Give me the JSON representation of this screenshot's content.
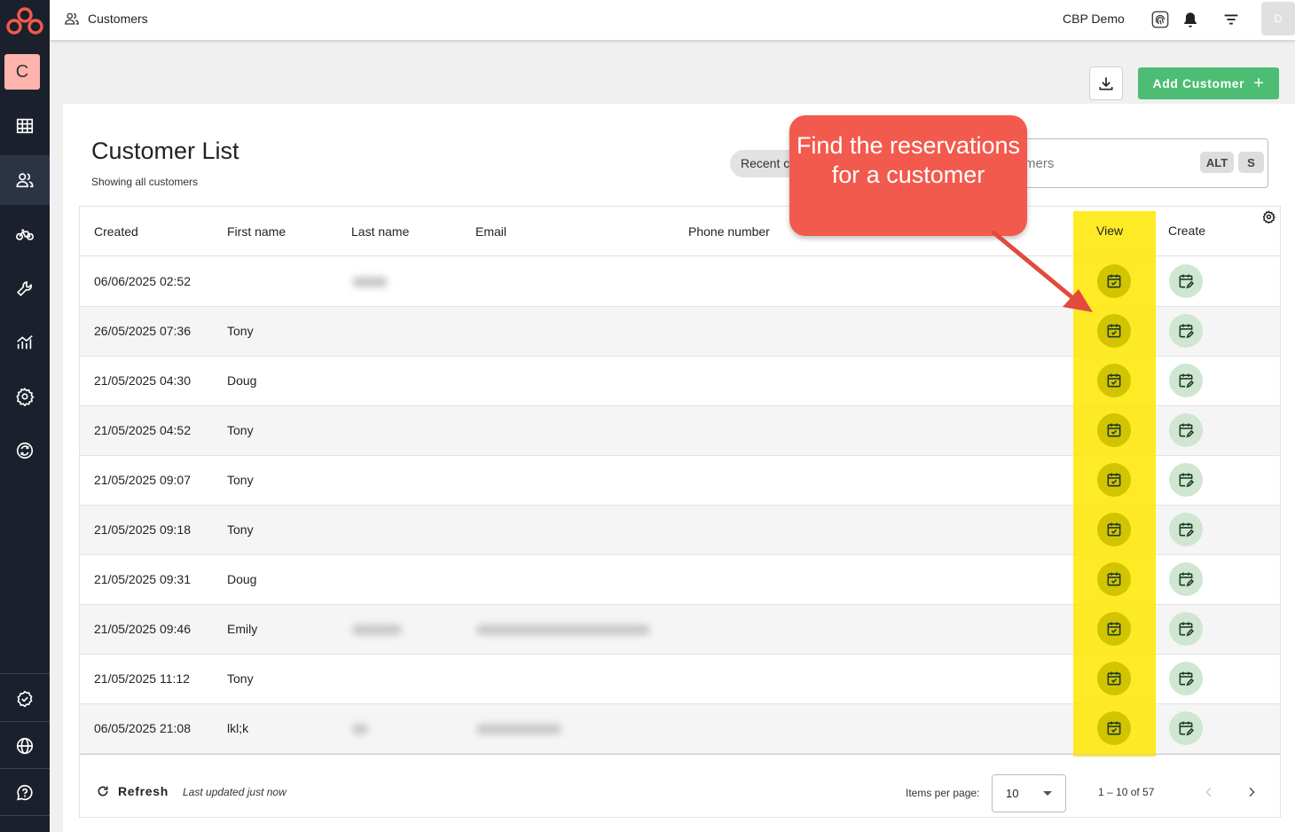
{
  "app": {
    "page_title": "Customers",
    "org_name": "CBP Demo",
    "avatar_initial": "D",
    "org_badge": "C"
  },
  "sidebar": {
    "items": [
      {
        "name": "dashboard",
        "icon": "grid-icon"
      },
      {
        "name": "customers",
        "icon": "users-icon",
        "active": true
      },
      {
        "name": "bikes",
        "icon": "bike-icon"
      },
      {
        "name": "service",
        "icon": "wrench-icon"
      },
      {
        "name": "reports",
        "icon": "chart-icon"
      },
      {
        "name": "settings",
        "icon": "gear-icon"
      },
      {
        "name": "sync",
        "icon": "sync-icon"
      },
      {
        "name": "verified",
        "icon": "badge-check-icon"
      },
      {
        "name": "globe",
        "icon": "globe-icon"
      },
      {
        "name": "help",
        "icon": "help-icon"
      }
    ]
  },
  "actions": {
    "add_customer_label": "Add Customer",
    "add_icon": "+"
  },
  "list": {
    "title": "Customer List",
    "subtitle": "Showing all customers",
    "chip_label": "Recent c",
    "search_placeholder": "mers",
    "kbd_alt": "ALT",
    "kbd_s": "S"
  },
  "table": {
    "columns": [
      "Created",
      "First name",
      "Last name",
      "Email",
      "Phone number",
      "View",
      "Create"
    ],
    "rows": [
      {
        "created": "06/06/2025 02:52",
        "first": ""
      },
      {
        "created": "26/05/2025 07:36",
        "first": "Tony"
      },
      {
        "created": "21/05/2025 04:30",
        "first": "Doug"
      },
      {
        "created": "21/05/2025 04:52",
        "first": "Tony"
      },
      {
        "created": "21/05/2025 09:07",
        "first": "Tony"
      },
      {
        "created": "21/05/2025 09:18",
        "first": "Tony"
      },
      {
        "created": "21/05/2025 09:31",
        "first": "Doug"
      },
      {
        "created": "21/05/2025 09:46",
        "first": "Emily"
      },
      {
        "created": "21/05/2025 11:12",
        "first": "Tony"
      },
      {
        "created": "06/05/2025 21:08",
        "first": "lkl;k"
      }
    ]
  },
  "footer": {
    "refresh_label": "Refresh",
    "last_updated": "Last updated just now",
    "items_per_page_label": "Items per page:",
    "items_per_page": "10",
    "range": "1 – 10 of 57"
  },
  "annotation": {
    "callout_text": "Find the reservations for a customer",
    "highlight_color": "#ffe600",
    "callout_color": "#f25a4d"
  },
  "colors": {
    "sidebar": "#1b212c",
    "primary_green": "#4dbd74"
  }
}
